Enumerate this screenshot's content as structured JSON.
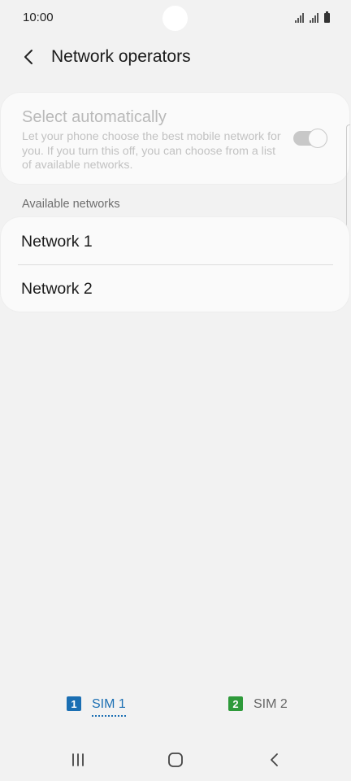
{
  "status_bar": {
    "time": "10:00",
    "icons": [
      "signal-sim1-icon",
      "signal-sim2-icon",
      "battery-icon"
    ]
  },
  "header": {
    "back_icon": "chevron-left-icon",
    "title": "Network operators"
  },
  "auto_select": {
    "title": "Select automatically",
    "description": "Let your phone choose the best mobile network for you. If you turn this off, you can choose from a list of available networks.",
    "toggle_on": true,
    "enabled": false
  },
  "available": {
    "header": "Available networks",
    "items": [
      {
        "label": "Network 1"
      },
      {
        "label": "Network 2"
      }
    ]
  },
  "sim_tabs": [
    {
      "badge": "1",
      "label": "SIM 1",
      "selected": true,
      "color": "#1b6fb3"
    },
    {
      "badge": "2",
      "label": "SIM 2",
      "selected": false,
      "color": "#2e9a3a"
    }
  ],
  "nav_bar": {
    "icons": [
      "recents-icon",
      "home-icon",
      "back-icon"
    ]
  }
}
